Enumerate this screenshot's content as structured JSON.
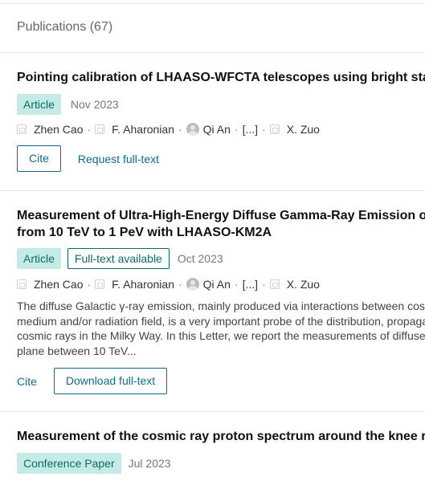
{
  "section": {
    "title": "Publications (67)"
  },
  "publications": [
    {
      "title": "Pointing calibration of LHAASO-WFCTA telescopes using bright sta",
      "type": "Article",
      "date": "Nov 2023",
      "authors": [
        "Zhen Cao",
        "F. Aharonian",
        "Qi An",
        "[...]",
        "X. Zuo"
      ],
      "actions": {
        "cite": "Cite",
        "secondary": "Request full-text"
      }
    },
    {
      "title_lines": [
        "Measurement of Ultra-High-Energy Diffuse Gamma-Ray Emission o",
        "from 10 TeV to 1 PeV with LHAASO-KM2A"
      ],
      "type": "Article",
      "availability": "Full-text available",
      "date": "Oct 2023",
      "authors": [
        "Zhen Cao",
        "F. Aharonian",
        "Qi An",
        "[...]",
        "X. Zuo"
      ],
      "abstract_lines": [
        "The diffuse Galactic γ-ray emission, mainly produced via interactions between cos",
        "medium and/or radiation field, is a very important probe of the distribution, propaga",
        "cosmic rays in the Milky Way. In this Letter, we report the measurements of diffuse",
        "plane between 10 TeV..."
      ],
      "actions": {
        "cite": "Cite",
        "secondary": "Download full-text"
      }
    },
    {
      "title": "Measurement of the cosmic ray proton spectrum around the knee r",
      "type": "Conference Paper",
      "date": "Jul 2023"
    }
  ]
}
